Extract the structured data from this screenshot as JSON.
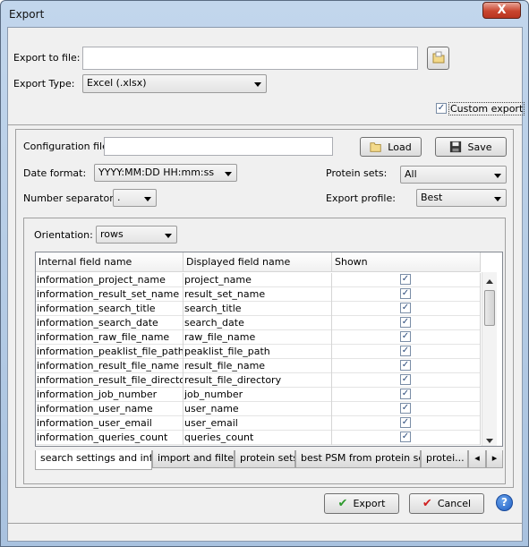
{
  "window": {
    "title": "Export",
    "close_label": "X"
  },
  "export_to_file": {
    "label": "Export to file:",
    "value": ""
  },
  "export_type": {
    "label": "Export Type:",
    "value": "Excel (.xlsx)"
  },
  "custom_export": {
    "label": "Custom export",
    "checked": true
  },
  "config": {
    "file_label": "Configuration file:",
    "file_value": "",
    "load_label": "Load",
    "save_label": "Save"
  },
  "date_format": {
    "label": "Date format:",
    "value": "YYYY:MM:DD HH:mm:ss"
  },
  "number_separator": {
    "label": "Number separator:",
    "value": "."
  },
  "protein_sets": {
    "label": "Protein sets:",
    "value": "All"
  },
  "export_profile": {
    "label": "Export profile:",
    "value": "Best"
  },
  "orientation": {
    "label": "Orientation:",
    "value": "rows"
  },
  "table": {
    "columns": [
      "Internal field name",
      "Displayed field name",
      "Shown"
    ],
    "rows": [
      {
        "internal": "information_project_name",
        "displayed": "project_name",
        "shown": true
      },
      {
        "internal": "information_result_set_name",
        "displayed": "result_set_name",
        "shown": true
      },
      {
        "internal": "information_search_title",
        "displayed": "search_title",
        "shown": true
      },
      {
        "internal": "information_search_date",
        "displayed": "search_date",
        "shown": true
      },
      {
        "internal": "information_raw_file_name",
        "displayed": "raw_file_name",
        "shown": true
      },
      {
        "internal": "information_peaklist_file_path",
        "displayed": "peaklist_file_path",
        "shown": true
      },
      {
        "internal": "information_result_file_name",
        "displayed": "result_file_name",
        "shown": true
      },
      {
        "internal": "information_result_file_directory",
        "displayed": "result_file_directory",
        "shown": true
      },
      {
        "internal": "information_job_number",
        "displayed": "job_number",
        "shown": true
      },
      {
        "internal": "information_user_name",
        "displayed": "user_name",
        "shown": true
      },
      {
        "internal": "information_user_email",
        "displayed": "user_email",
        "shown": true
      },
      {
        "internal": "information_queries_count",
        "displayed": "queries_count",
        "shown": true
      }
    ]
  },
  "tabs": [
    "search settings and infos",
    "import and filters",
    "protein sets",
    "best PSM from protein sets",
    "protei..."
  ],
  "buttons": {
    "export_label": "Export",
    "cancel_label": "Cancel",
    "help_label": "?"
  }
}
